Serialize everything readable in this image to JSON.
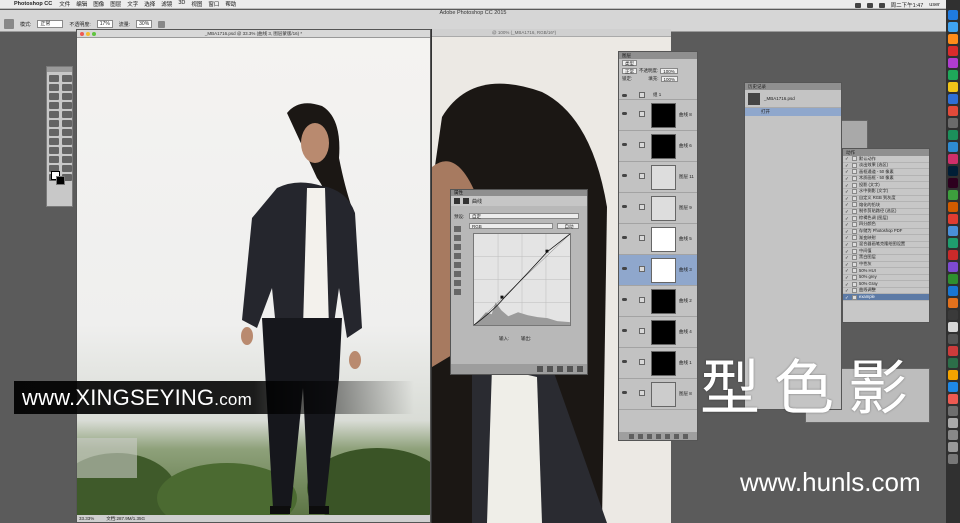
{
  "menubar": {
    "apple": "",
    "app": "Photoshop CC",
    "items": [
      "文件",
      "编辑",
      "图像",
      "图层",
      "文字",
      "选择",
      "滤镜",
      "3D",
      "视图",
      "窗口",
      "帮助"
    ],
    "clock": "周二下午1:47",
    "user": "user"
  },
  "optionbar": {
    "app_title": "Adobe Photoshop CC 2015",
    "mode_label": "模式:",
    "mode_value": "正常",
    "opacity_label": "不透明度:",
    "opacity_value": "17%",
    "flow_label": "流量:",
    "flow_value": "30%"
  },
  "document": {
    "title": "_MBA1716.psd @ 33.3% (曲线 3, 图层蒙版/16) *",
    "zoom": "33.33%",
    "doc_size": "文档:287.9M/1.35G"
  },
  "document2": {
    "title": "@ 100% (_MBA1716, RGB/16*)"
  },
  "curves": {
    "panel_title": "属性",
    "section": "曲线",
    "preset_label": "预设:",
    "preset_value": "自定",
    "channel_value": "RGB",
    "auto_label": "自动",
    "input_label": "输入:",
    "output_label": "输出:"
  },
  "layers": {
    "panel_title": "图层",
    "kind_label": "类型",
    "blend": "正常",
    "opacity_label": "不透明度:",
    "opacity_value": "100%",
    "lock_label": "锁定:",
    "fill_label": "填充:",
    "fill_value": "100%",
    "items": [
      {
        "name": "组 1",
        "type": "group",
        "thumb": "#444"
      },
      {
        "name": "曲线 8",
        "type": "adj",
        "thumb": "#000"
      },
      {
        "name": "曲线 6",
        "type": "adj",
        "thumb": "#000"
      },
      {
        "name": "图层 11",
        "type": "pixel",
        "thumb": "#ddd"
      },
      {
        "name": "图层 9",
        "type": "pixel",
        "thumb": "#ddd"
      },
      {
        "name": "曲线 5",
        "type": "adj",
        "thumb": "#fff"
      },
      {
        "name": "曲线 3",
        "type": "adj",
        "thumb": "#fff",
        "active": true
      },
      {
        "name": "曲线 2",
        "type": "adj",
        "thumb": "#000"
      },
      {
        "name": "曲线 4",
        "type": "adj",
        "thumb": "#000"
      },
      {
        "name": "曲线 1",
        "type": "adj",
        "thumb": "#000"
      },
      {
        "name": "图层 8",
        "type": "pixel",
        "thumb": "#ccc"
      }
    ]
  },
  "history": {
    "panel_title": "历史记录",
    "snapshot": "_MBA1716.psd",
    "item": "打开"
  },
  "actions": {
    "panel_title": "动作",
    "items": [
      {
        "label": "默认动作",
        "dark": false
      },
      {
        "label": "淡出效果 (选区)",
        "dark": false
      },
      {
        "label": "画框通道 - 50 像素",
        "dark": false
      },
      {
        "label": "木质画框 - 50 像素",
        "dark": false
      },
      {
        "label": "投影 (文字)",
        "dark": false
      },
      {
        "label": "水中倒影 (文字)",
        "dark": false
      },
      {
        "label": "自定义 RGB 到灰度",
        "dark": false
      },
      {
        "label": "熔化的铅块",
        "dark": false
      },
      {
        "label": "制作剪贴路径 (选区)",
        "dark": false
      },
      {
        "label": "棕褐色调 (图层)",
        "dark": false
      },
      {
        "label": "四分颜色",
        "dark": false
      },
      {
        "label": "存储为 Photoshop PDF",
        "dark": false
      },
      {
        "label": "渐变映射",
        "dark": false
      },
      {
        "label": "混合器画笔克隆绘图设置",
        "dark": false
      },
      {
        "label": "中间值",
        "dark": false
      },
      {
        "label": "黑白图层",
        "dark": false
      },
      {
        "label": "中性灰",
        "dark": false
      },
      {
        "label": "50% HUI",
        "dark": false
      },
      {
        "label": "50% grey",
        "dark": false
      },
      {
        "label": "50% Gray",
        "dark": false
      },
      {
        "label": "曲线调整",
        "dark": false
      },
      {
        "label": "example",
        "dark": true
      }
    ]
  },
  "watermark": {
    "url": "www.XINGSEYING",
    "suffix": ".com",
    "brand_cn": "型色影",
    "site2": "www.hunls.com"
  },
  "colors": {
    "selection": "#8fa7cc",
    "panel": "#c2c2c2",
    "dark_bg": "#5b5b5b"
  }
}
